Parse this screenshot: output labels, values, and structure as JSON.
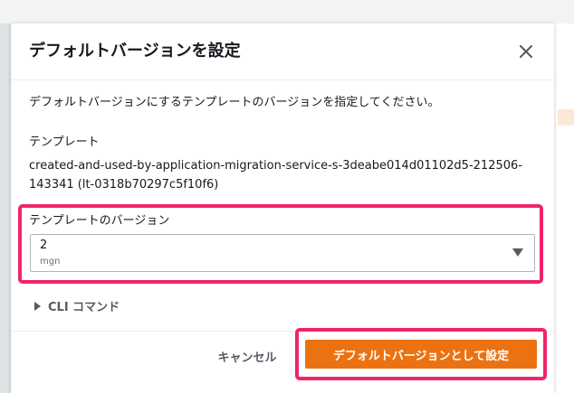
{
  "colors": {
    "accent": "#ec7211",
    "highlight": "#f0246e",
    "text": "#16191f",
    "muted": "#687078",
    "border": "#aab7b8"
  },
  "dialog": {
    "title": "デフォルトバージョンを設定",
    "close_icon": "close-icon",
    "description": "デフォルトバージョンにするテンプレートのバージョンを指定してください。",
    "template_label": "テンプレート",
    "template_name": "created-and-used-by-application-migration-service-s-3deabe014d01102d5-212506-143341 (lt-0318b70297c5f10f6)",
    "version_label": "テンプレートのバージョン",
    "version_select": {
      "value": "2",
      "description": "mgn",
      "caret_icon": "caret-down-icon"
    },
    "cli_label": "CLI コマンド",
    "cancel_label": "キャンセル",
    "submit_label": "デフォルトバージョンとして設定"
  }
}
